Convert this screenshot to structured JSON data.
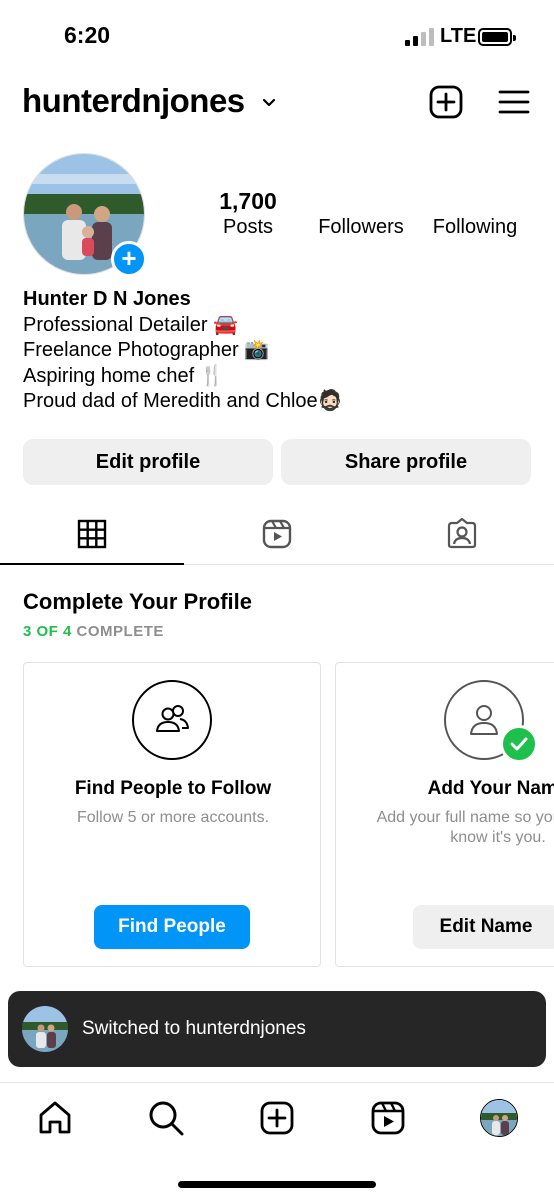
{
  "status_bar": {
    "time": "6:20",
    "network": "LTE"
  },
  "header": {
    "username": "hunterdnjones"
  },
  "profile": {
    "stats": {
      "posts_count": "1,700",
      "posts_label": "Posts",
      "followers_count": "",
      "followers_label": "Followers",
      "following_count": "",
      "following_label": "Following"
    },
    "bio": {
      "name": "Hunter D N Jones",
      "lines": [
        "Professional Detailer 🚘",
        "Freelance Photographer 📸",
        "Aspiring home chef 🍴",
        "Proud dad of Meredith and Chloe🧔🏻"
      ]
    },
    "buttons": {
      "edit": "Edit profile",
      "share": "Share profile"
    }
  },
  "complete_profile": {
    "title": "Complete Your Profile",
    "progress_count": "3 OF 4",
    "progress_word": "COMPLETE",
    "cards": [
      {
        "title": "Find People to Follow",
        "description": "Follow 5 or more accounts.",
        "button": "Find People",
        "icon": "people-icon"
      },
      {
        "title": "Add Your Name",
        "description": "Add your full name so your friends know it's you.",
        "button": "Edit Name",
        "icon": "person-icon",
        "completed": true
      }
    ]
  },
  "toast": {
    "message": "Switched to hunterdnjones"
  },
  "colors": {
    "accent_blue": "#0095f6",
    "complete_green": "#1fbf4e",
    "toast_bg": "#262626"
  }
}
